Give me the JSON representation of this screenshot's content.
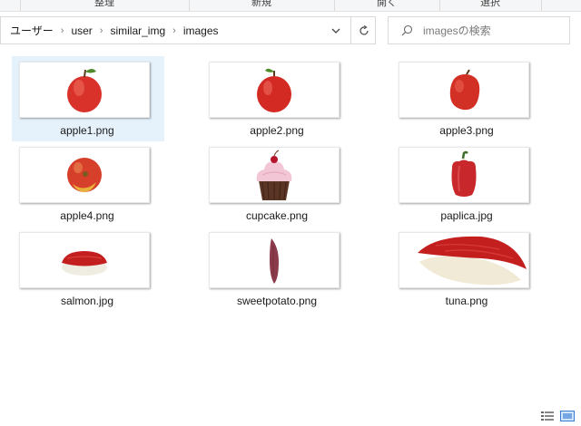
{
  "ribbon": {
    "groups": [
      "",
      "整理",
      "新規",
      "開く",
      "選択"
    ]
  },
  "address": {
    "crumbs": [
      "ユーザー",
      "user",
      "similar_img",
      "images"
    ]
  },
  "search": {
    "placeholder": "imagesの検索"
  },
  "files": [
    {
      "name": "apple1.png",
      "icon": "apple-thumbnail",
      "selected": true
    },
    {
      "name": "apple2.png",
      "icon": "apple-thumbnail",
      "selected": false
    },
    {
      "name": "apple3.png",
      "icon": "apple-thumbnail",
      "selected": false
    },
    {
      "name": "apple4.png",
      "icon": "apple-thumbnail",
      "selected": false
    },
    {
      "name": "cupcake.png",
      "icon": "cupcake-thumbnail",
      "selected": false
    },
    {
      "name": "paplica.jpg",
      "icon": "bell-pepper-thumbnail",
      "selected": false
    },
    {
      "name": "salmon.jpg",
      "icon": "sushi-thumbnail",
      "selected": false
    },
    {
      "name": "sweetpotato.png",
      "icon": "sweet-potato-thumbnail",
      "selected": false
    },
    {
      "name": "tuna.png",
      "icon": "sushi-thumbnail",
      "selected": false
    }
  ],
  "colors": {
    "selection": "#e5f1fb",
    "apple_red": "#d8322b",
    "sushi_red": "#c41f1f"
  }
}
